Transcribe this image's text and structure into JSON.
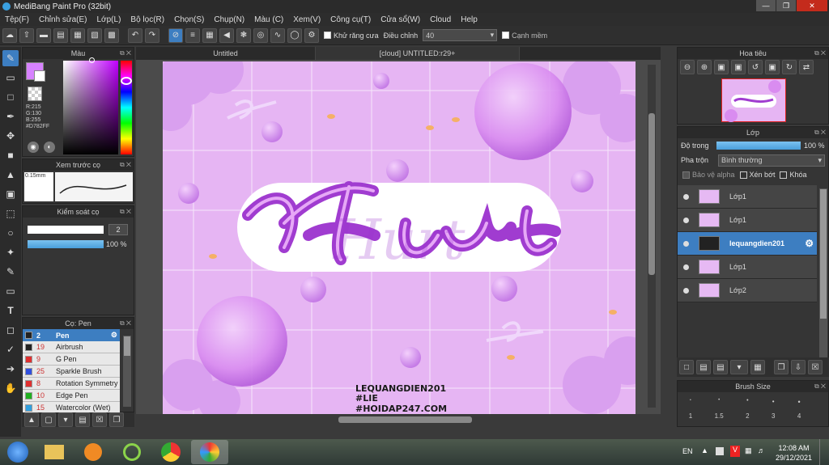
{
  "window": {
    "title": "MediBang Paint Pro (32bit)"
  },
  "menu": [
    "Tệp(F)",
    "Chỉnh sửa(E)",
    "Lớp(L)",
    "Bộ lọc(R)",
    "Chọn(S)",
    "Chụp(N)",
    "Màu (C)",
    "Xem(V)",
    "Công cụ(T)",
    "Cửa sổ(W)",
    "Cloud",
    "Help"
  ],
  "toolbar": {
    "antialias_label": "Khử răng cưa",
    "adjust_label": "Điều chỉnh",
    "adjust_value": "40",
    "edge_label": "Cạnh mềm"
  },
  "color_panel": {
    "title": "Màu",
    "r": "R:215",
    "g": "G:130",
    "b": "B:255",
    "hex": "#D782FF",
    "fg_color": "#D782FF"
  },
  "brush_preview": {
    "title": "Xem trước cọ",
    "size": "0.15mm"
  },
  "brush_control": {
    "title": "Kiểm soát cọ",
    "size_value": "2",
    "opacity_value": "100 %"
  },
  "brush_list": {
    "title": "Cọ: Pen",
    "items": [
      {
        "size": "2",
        "name": "Pen",
        "color": "#222222"
      },
      {
        "size": "19",
        "name": "Airbrush",
        "color": "#222222"
      },
      {
        "size": "9",
        "name": "G Pen",
        "color": "#e03030"
      },
      {
        "size": "25",
        "name": "Sparkle Brush",
        "color": "#3050e0"
      },
      {
        "size": "8",
        "name": "Rotation Symmetry",
        "color": "#e03030"
      },
      {
        "size": "10",
        "name": "Edge Pen",
        "color": "#20b020"
      },
      {
        "size": "15",
        "name": "Watercolor (Wet)",
        "color": "#30a0e0"
      }
    ]
  },
  "tabs": [
    "Untitled",
    "[cloud] UNTITLED:r29+"
  ],
  "artwork": {
    "word": "Hurt",
    "watermark": [
      "LEQUANGDIEN201",
      "#LIE",
      "#HOIDAP247.COM"
    ]
  },
  "navigator": {
    "title": "Hoa tiêu"
  },
  "layer_panel": {
    "title": "Lớp",
    "opacity_label": "Độ trong",
    "opacity_value": "100 %",
    "blend_label": "Pha trộn",
    "blend_value": "Bình thường",
    "protect_alpha_label": "Bảo vệ alpha",
    "clip_label": "Xén bớt",
    "lock_label": "Khóa",
    "layers": [
      {
        "name": "Lớp1",
        "selected": false
      },
      {
        "name": "Lớp1",
        "selected": false
      },
      {
        "name": "lequangdien201",
        "selected": true
      },
      {
        "name": "Lớp1",
        "selected": false
      },
      {
        "name": "Lớp2",
        "selected": false
      }
    ]
  },
  "brush_size_panel": {
    "title": "Brush Size",
    "sizes": [
      "1",
      "1.5",
      "2",
      "3",
      "4"
    ]
  },
  "taskbar": {
    "lang": "EN",
    "time": "12:08 AM",
    "date": "29/12/2021"
  }
}
